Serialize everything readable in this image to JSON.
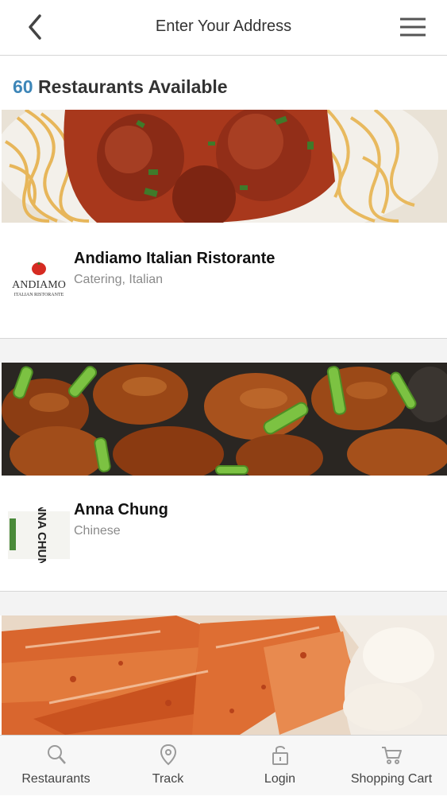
{
  "header": {
    "title": "Enter Your Address",
    "back_icon": "chevron-left-icon",
    "menu_icon": "hamburger-menu-icon"
  },
  "listing": {
    "count": "60",
    "count_label": "Restaurants Available",
    "accent_color": "#3d86b8"
  },
  "restaurants": [
    {
      "name": "Andiamo Italian Ristorante",
      "categories": "Catering, Italian",
      "logo_text": "ANDIAMO",
      "logo_subtext": "ITALIAN RISTORANTE",
      "photo": "spaghetti-meatballs"
    },
    {
      "name": "Anna Chung",
      "categories": "Chinese",
      "logo_text": "ANNA CHUNG",
      "photo": "orange-chicken-scallions"
    },
    {
      "photo": "king-crab-legs"
    }
  ],
  "bottom_nav": [
    {
      "label": "Restaurants",
      "icon": "search-icon"
    },
    {
      "label": "Track",
      "icon": "map-pin-icon"
    },
    {
      "label": "Login",
      "icon": "padlock-icon"
    },
    {
      "label": "Shopping Cart",
      "icon": "cart-icon"
    }
  ]
}
